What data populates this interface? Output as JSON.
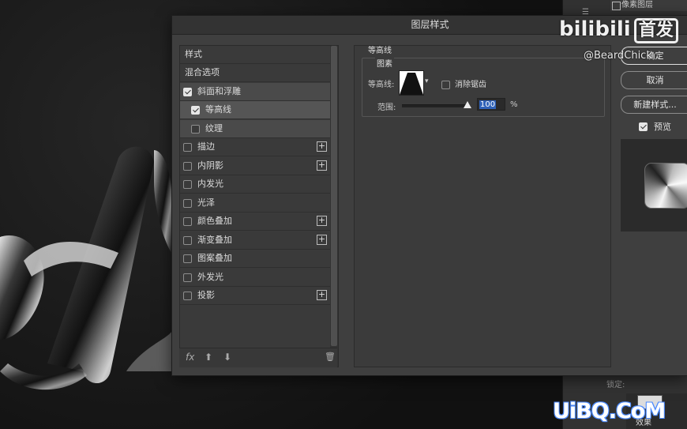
{
  "dialog": {
    "title": "图层样式"
  },
  "style_list": {
    "header": "样式",
    "items": [
      {
        "label": "混合选项",
        "checkbox": false,
        "checked": false,
        "plus": false,
        "indent": 0
      },
      {
        "label": "斜面和浮雕",
        "checkbox": true,
        "checked": true,
        "plus": false,
        "indent": 0
      },
      {
        "label": "等高线",
        "checkbox": true,
        "checked": true,
        "plus": false,
        "indent": 1
      },
      {
        "label": "纹理",
        "checkbox": true,
        "checked": false,
        "plus": false,
        "indent": 1
      },
      {
        "label": "描边",
        "checkbox": true,
        "checked": false,
        "plus": true,
        "indent": 0
      },
      {
        "label": "内阴影",
        "checkbox": true,
        "checked": false,
        "plus": true,
        "indent": 0
      },
      {
        "label": "内发光",
        "checkbox": true,
        "checked": false,
        "plus": false,
        "indent": 0
      },
      {
        "label": "光泽",
        "checkbox": true,
        "checked": false,
        "plus": false,
        "indent": 0
      },
      {
        "label": "颜色叠加",
        "checkbox": true,
        "checked": false,
        "plus": true,
        "indent": 0
      },
      {
        "label": "渐变叠加",
        "checkbox": true,
        "checked": false,
        "plus": true,
        "indent": 0
      },
      {
        "label": "图案叠加",
        "checkbox": true,
        "checked": false,
        "plus": false,
        "indent": 0
      },
      {
        "label": "外发光",
        "checkbox": true,
        "checked": false,
        "plus": false,
        "indent": 0
      },
      {
        "label": "投影",
        "checkbox": true,
        "checked": false,
        "plus": true,
        "indent": 0
      }
    ],
    "footer": {
      "fx": "fx",
      "up": "⬆",
      "down": "⬇",
      "trash": "🗑"
    }
  },
  "contour_panel": {
    "section_title": "等高线",
    "group_title": "图素",
    "contour_label": "等高线:",
    "anti_alias_label": "消除锯齿",
    "anti_alias_checked": false,
    "range_label": "范围:",
    "range_value": "100",
    "range_unit": "%"
  },
  "buttons": {
    "ok": "确定",
    "cancel": "取消",
    "new_style": "新建样式...",
    "preview_label": "预览",
    "preview_checked": true
  },
  "background_panel": {
    "layer_name": "像素图层",
    "lock_label": "锁定:",
    "effects_label": "效果"
  },
  "watermarks": {
    "bili_logo": "bilibili",
    "bili_box": "首发",
    "bili_user": "@BeardChick",
    "site": "UiBQ.CoM"
  }
}
